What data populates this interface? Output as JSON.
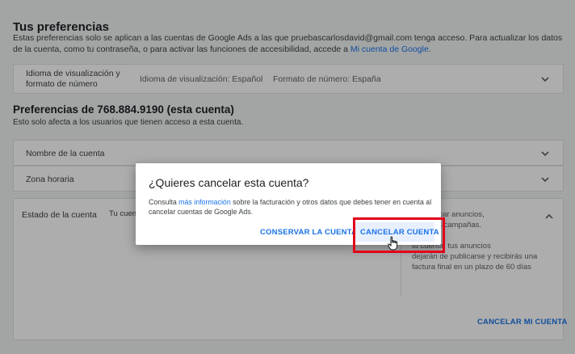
{
  "prefs": {
    "title": "Tus preferencias",
    "desc_1": "Estas preferencias solo se aplican a las cuentas de Google Ads a las que ",
    "email": "pruebascarlosdavid@gmail.com",
    "desc_2": " tenga acceso. Para actualizar los datos de la cuenta, como tu contraseña, o para activar las funciones de accesibilidad, accede a ",
    "link": "Mi cuenta de Google",
    "desc_3": ".",
    "display_label": "Idioma de visualización y formato de número",
    "display_lang": "Idioma de visualización: Español",
    "number_format": "Formato de número: España"
  },
  "account": {
    "title": "Preferencias de 768.884.9190 (esta cuenta)",
    "desc": "Esto solo afecta a los usuarios que tienen acceso a esta cuenta.",
    "name_label": "Nombre de la cuenta",
    "timezone_label": "Zona horaria",
    "status_label": "Estado de la cuenta",
    "status_value_fragment": "Tu cuent",
    "right_note_top": "de publicar anuncios,\ntener tus campañas.",
    "right_note_bottom": "tu cuenta, tus anuncios\ndejarán de publicarse y recibirás una\nfactura final en un plazo de 60 días",
    "cancel_my_account": "CANCELAR MI CUENTA"
  },
  "dialog": {
    "title": "¿Quieres cancelar esta cuenta?",
    "body_1": "Consulta ",
    "body_link": "más información",
    "body_2": " sobre la facturación y otros datos que debes tener en cuenta al cancelar cuentas de Google Ads.",
    "keep_label": "CONSERVAR LA CUENTA",
    "cancel_label": "CANCELAR CUENTA"
  },
  "colors": {
    "accent": "#1a73e8",
    "highlight": "#e2001a"
  },
  "icons": [
    "chevron-down-icon",
    "chevron-up-icon",
    "hand-cursor-icon"
  ]
}
